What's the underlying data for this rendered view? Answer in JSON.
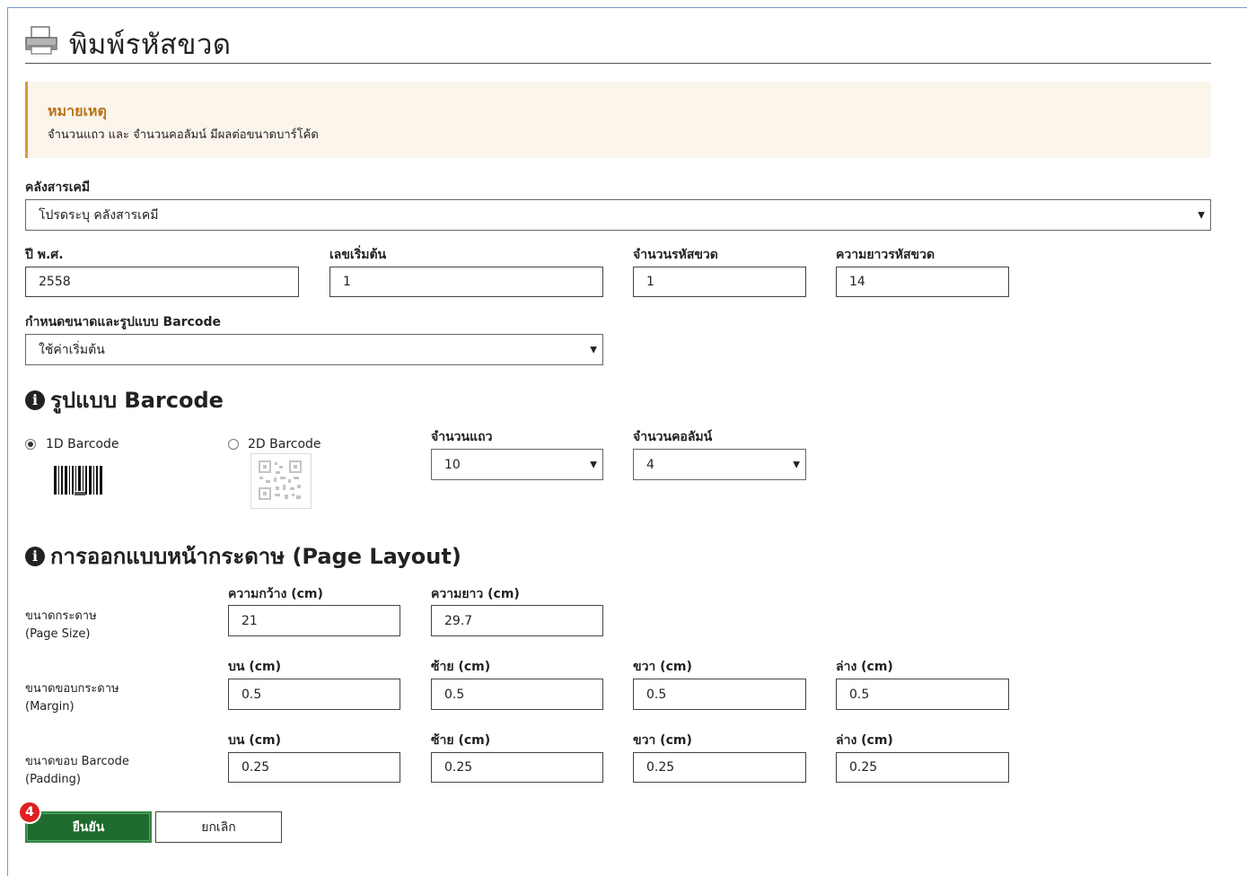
{
  "header": {
    "title": "พิมพ์รหัสขวด",
    "icon": "printer-icon"
  },
  "note": {
    "title": "หมายเหตุ",
    "text": "จำนวนแถว และ จำนวนคอลัมน์ มีผลต่อขนาดบาร์โค้ด"
  },
  "form": {
    "warehouse": {
      "label": "คลังสารเคมี",
      "value": "โปรดระบุ คลังสารเคมี"
    },
    "year": {
      "label": "ปี พ.ศ.",
      "value": "2558"
    },
    "start_number": {
      "label": "เลขเริ่มต้น",
      "value": "1"
    },
    "bottle_count": {
      "label": "จำนวนรหัสขวด",
      "value": "1"
    },
    "code_length": {
      "label": "ความยาวรหัสขวด",
      "value": "14"
    },
    "barcode_preset": {
      "label": "กำหนดขนาดและรูปแบบ Barcode",
      "value": "ใช้ค่าเริ่มต้น"
    }
  },
  "barcode_section": {
    "heading": "รูปแบบ Barcode",
    "option_1d": {
      "label": "1D Barcode",
      "selected": true
    },
    "option_2d": {
      "label": "2D Barcode",
      "selected": false
    },
    "rows": {
      "label": "จำนวนแถว",
      "value": "10"
    },
    "columns": {
      "label": "จำนวนคอลัมน์",
      "value": "4"
    }
  },
  "layout_section": {
    "heading": "การออกแบบหน้ากระดาษ (Page Layout)",
    "page_size": {
      "label_th": "ขนาดกระดาษ",
      "label_en": "(Page Size)",
      "width_label": "ความกว้าง (cm)",
      "width_value": "21",
      "height_label": "ความยาว (cm)",
      "height_value": "29.7"
    },
    "margin": {
      "label_th": "ขนาดขอบกระดาษ",
      "label_en": "(Margin)",
      "top_label": "บน (cm)",
      "top_value": "0.5",
      "left_label": "ซ้าย (cm)",
      "left_value": "0.5",
      "right_label": "ขวา (cm)",
      "right_value": "0.5",
      "bottom_label": "ล่าง (cm)",
      "bottom_value": "0.5"
    },
    "padding": {
      "label_th": "ขนาดขอบ Barcode",
      "label_en": "(Padding)",
      "top_label": "บน (cm)",
      "top_value": "0.25",
      "left_label": "ซ้าย (cm)",
      "left_value": "0.25",
      "right_label": "ขวา (cm)",
      "right_value": "0.25",
      "bottom_label": "ล่าง (cm)",
      "bottom_value": "0.25"
    }
  },
  "actions": {
    "confirm": "ยืนยัน",
    "cancel": "ยกเลิก",
    "step_badge": "4"
  },
  "colors": {
    "note_accent": "#d59a43",
    "note_bg": "#fcf5ec",
    "confirm_bg": "#1f6b2f",
    "badge": "#e02020"
  }
}
